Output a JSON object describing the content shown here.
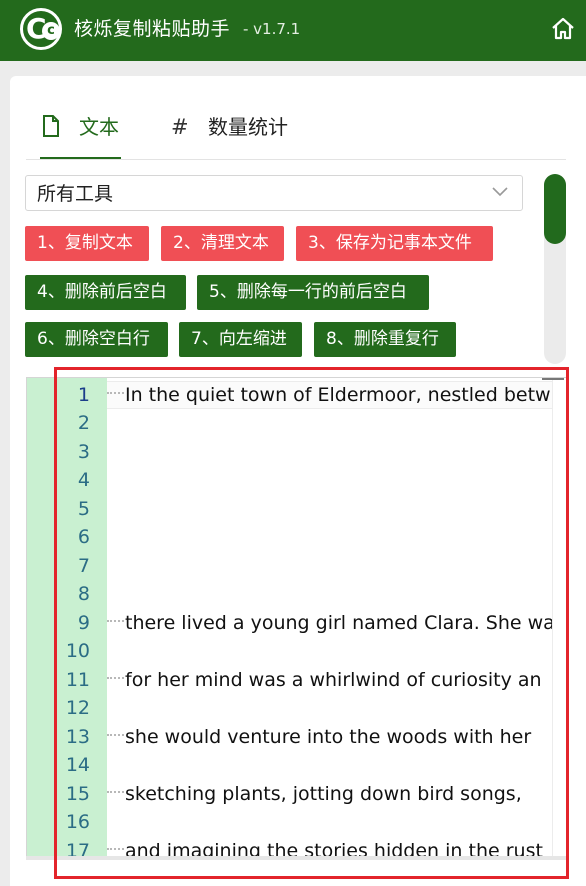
{
  "app": {
    "title": "核烁复制粘贴助手",
    "version": "- v1.7.1",
    "logo_letter": "C",
    "logo_inner": "c"
  },
  "tabs": [
    {
      "label": "文本",
      "icon": "document-icon",
      "active": true
    },
    {
      "label": "数量统计",
      "icon": "hash-icon",
      "active": false
    }
  ],
  "tool_select": {
    "value": "所有工具"
  },
  "buttons": [
    {
      "label": "1、复制文本",
      "color": "#f04f55"
    },
    {
      "label": "2、清理文本",
      "color": "#f04f55"
    },
    {
      "label": "3、保存为记事本文件",
      "color": "#f04f55"
    },
    {
      "label": "4、删除前后空白",
      "color": "#236a1c"
    },
    {
      "label": "5、删除每一行的前后空白",
      "color": "#236a1c"
    },
    {
      "label": "6、删除空白行",
      "color": "#236a1c"
    },
    {
      "label": "7、向左缩进",
      "color": "#236a1c"
    },
    {
      "label": "8、删除重复行",
      "color": "#236a1c"
    }
  ],
  "editor": {
    "line_numbers": [
      "1",
      "2",
      "3",
      "4",
      "5",
      "6",
      "7",
      "8",
      "9",
      "10",
      "11",
      "12",
      "13",
      "14",
      "15",
      "16",
      "17"
    ],
    "lines": {
      "l1": "In the quiet town of Eldermoor, nestled betw",
      "l9": "there lived a young girl named Clara. She wa",
      "l11": "for her mind was a whirlwind of curiosity an",
      "l13": "she would venture into the woods with her",
      "l15": "sketching plants, jotting down bird songs,",
      "l17": "and imagining the stories hidden in the rust"
    }
  },
  "colors": {
    "brand_green": "#236a1c",
    "danger_red": "#f04f55",
    "gutter_green": "#c9f0d1",
    "highlight_red": "#e3242b"
  }
}
